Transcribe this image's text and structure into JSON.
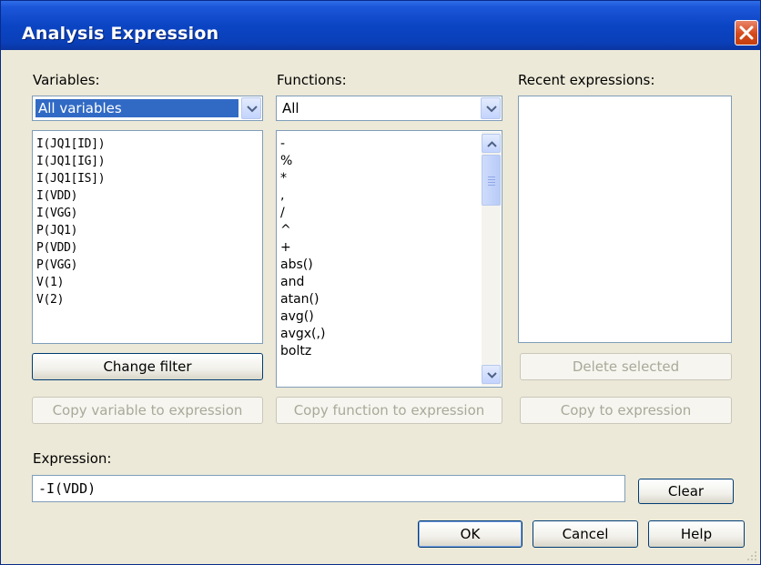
{
  "window": {
    "title": "Analysis Expression"
  },
  "variables": {
    "label": "Variables:",
    "filter_value": "All variables",
    "items": [
      "I(JQ1[ID])",
      "I(JQ1[IG])",
      "I(JQ1[IS])",
      "I(VDD)",
      "I(VGG)",
      "P(JQ1)",
      "P(VDD)",
      "P(VGG)",
      "V(1)",
      "V(2)"
    ],
    "change_filter_label": "Change filter",
    "copy_label": "Copy variable to expression"
  },
  "functions": {
    "label": "Functions:",
    "filter_value": "All",
    "items": [
      "-",
      "%",
      "*",
      ",",
      "/",
      "^",
      "+",
      "abs()",
      "and",
      "atan()",
      "avg()",
      "avgx(,)",
      "boltz"
    ],
    "copy_label": "Copy function to expression"
  },
  "recent": {
    "label": "Recent expressions:",
    "items": [],
    "delete_label": "Delete selected",
    "copy_label": "Copy to expression"
  },
  "expression": {
    "label": "Expression:",
    "value": "-I(VDD)",
    "clear_label": "Clear"
  },
  "footer": {
    "ok_label": "OK",
    "cancel_label": "Cancel",
    "help_label": "Help"
  },
  "colors": {
    "titlebar": "#0a45c4",
    "dialog_bg": "#ece9d8",
    "selection": "#316ac5",
    "close": "#d54a1c"
  }
}
